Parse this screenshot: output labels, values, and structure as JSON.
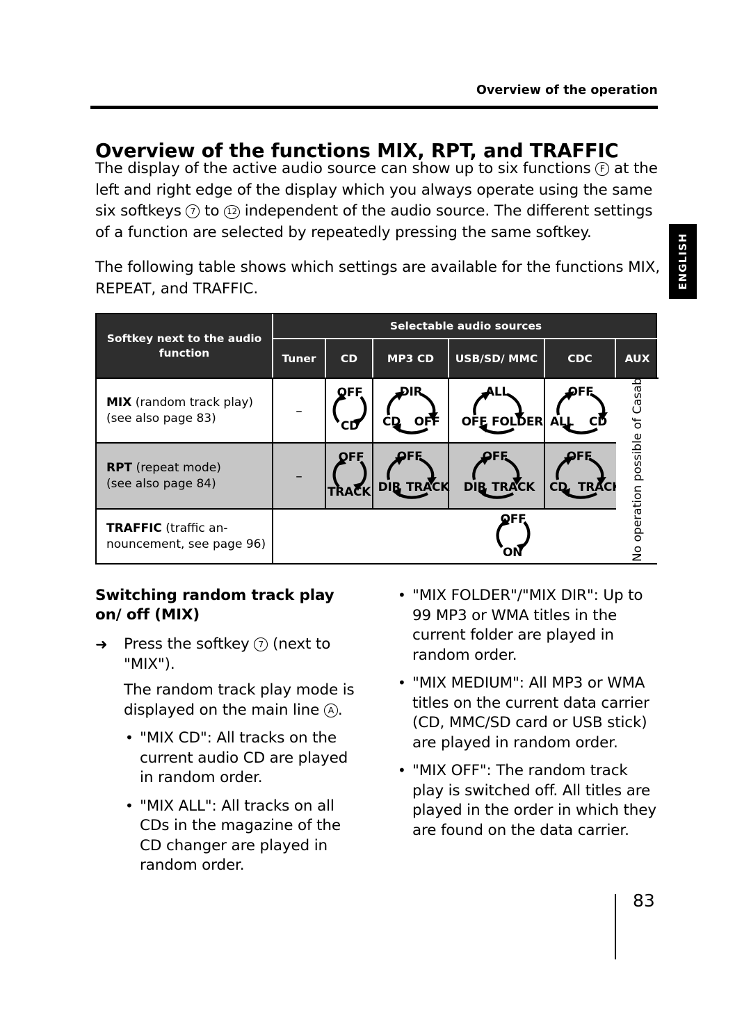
{
  "running_head": "Overview of the operation",
  "side_tab": {
    "label": "ENGLISH"
  },
  "page_title": "Overview of the functions MIX, RPT, and TRAFFIC",
  "intro": {
    "p1_a": "The display of the active audio source can show up to six functions ",
    "p1_f": "F",
    "p1_b": " at the left and right edge of the display which you always operate using the same six softkeys ",
    "p1_k7": "7",
    "p1_c": " to ",
    "p1_k12": "12",
    "p1_d": " independent of the audio source. The different settings of a function are selected by repeatedly pressing the same softkey.",
    "p2": "The following table shows which settings are available for the functions MIX, REPEAT, and TRAFFIC."
  },
  "table": {
    "header": {
      "softkey_col": "Softkey next to the audio function",
      "sources_group": "Selectable audio sources",
      "columns": [
        "Tuner",
        "CD",
        "MP3 CD",
        "USB/SD/ MMC",
        "CDC",
        "AUX"
      ]
    },
    "aux_note": "No operation possible of Casablanca",
    "rows": [
      {
        "label_bold": "MIX",
        "label_rest": " (random track play)",
        "label_line2": "(see also page 83)",
        "tuner": "–",
        "cd": {
          "states": [
            "OFF",
            "CD"
          ]
        },
        "mp3cd": {
          "states": [
            "DIR",
            "OFF",
            "CD"
          ]
        },
        "usbsd": {
          "states": [
            "ALL",
            "FOLDER",
            "OFF"
          ]
        },
        "cdc": {
          "states": [
            "OFF",
            "CD",
            "ALL"
          ]
        }
      },
      {
        "label_bold": "RPT",
        "label_rest": " (repeat mode)",
        "label_line2": "(see also page 84)",
        "tuner": "–",
        "cd": {
          "states": [
            "OFF",
            "TRACK"
          ]
        },
        "mp3cd": {
          "states": [
            "OFF",
            "TRACK",
            "DIR"
          ]
        },
        "usbsd": {
          "states": [
            "OFF",
            "TRACK",
            "DIR"
          ]
        },
        "cdc": {
          "states": [
            "OFF",
            "TRACK",
            "CD"
          ]
        }
      },
      {
        "label_bold": "TRAFFIC",
        "label_rest": " (traffic an-",
        "label_line2": "nouncement, see page 96)",
        "traffic": {
          "states": [
            "OFF",
            "ON"
          ]
        }
      }
    ]
  },
  "left_column": {
    "subhead": "Switching random track play on/ off (MIX)",
    "step_arrow": "➜",
    "step_a": "Press the softkey ",
    "step_key": "7",
    "step_b": " (next to \"MIX\").",
    "note_a": "The random track play mode is displayed on the main line ",
    "note_key": "A",
    "note_b": ".",
    "bullets": [
      "\"MIX CD\": All tracks on the current audio CD are played in random order.",
      "\"MIX ALL\": All tracks on all CDs in the magazine of the CD changer are played in random order."
    ]
  },
  "right_column": {
    "bullets": [
      "\"MIX FOLDER\"/\"MIX DIR\": Up to 99 MP3 or WMA titles in the current folder are played in random order.",
      "\"MIX MEDIUM\": All MP3 or WMA titles on the current data carrier (CD, MMC/SD card or USB stick) are played in random order.",
      "\"MIX OFF\": The random track play is switched off. All titles are played in the order in which they are found on the data carrier."
    ]
  },
  "footer": {
    "page_number": "83"
  }
}
